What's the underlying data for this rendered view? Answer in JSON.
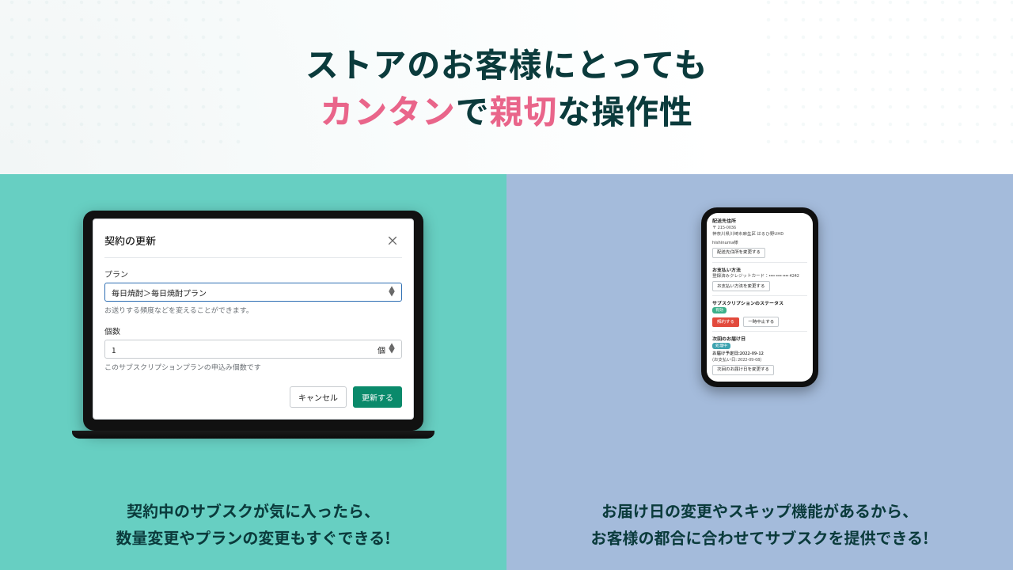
{
  "hero": {
    "line1_a": "ストアのお客様にとっても",
    "line2_pink1": "カンタン",
    "line2_mid": "で",
    "line2_pink2": "親切",
    "line2_end": "な操作性"
  },
  "panel_left": {
    "cap_line1": "契約中のサブスクが気に入ったら、",
    "cap_line2": "数量変更やプランの変更もすぐできる!"
  },
  "panel_right": {
    "cap_line1": "お届け日の変更やスキップ機能があるから、",
    "cap_line2": "お客様の都合に合わせてサブスクを提供できる!"
  },
  "modal": {
    "title": "契約の更新",
    "plan_label": "プラン",
    "plan_value": "毎日焼酎＞毎日焼酎プラン",
    "plan_help": "お送りする頻度などを変えることができます。",
    "qty_label": "個数",
    "qty_value": "1",
    "qty_unit": "個",
    "qty_help": "このサブスクリプションプランの申込み個数です",
    "cancel": "キャンセル",
    "submit": "更新する"
  },
  "phone": {
    "addr_title": "配送先住所",
    "addr_zip": "〒 215-0036",
    "addr_line": "神奈川県川崎市麻生区 はるひ野UHD",
    "addr_name": "hishinuma様",
    "addr_btn": "配送先住所を変更する",
    "pay_title": "お支払い方法",
    "pay_line": "登録済みクレジットカード：•••• •••• •••• 4242",
    "pay_btn": "お支払い方法を変更する",
    "status_title": "サブスクリプションのステータス",
    "status_pill": "有効",
    "status_cancel": "解約する",
    "status_pause": "一時中止する",
    "next_title": "次回のお届け日",
    "next_pill": "処理中",
    "next_line1": "お届け予定日:2022-09-12",
    "next_line2": "(お支払い日: 2022-09-08)",
    "next_btn": "次回のお届け日を変更する"
  }
}
